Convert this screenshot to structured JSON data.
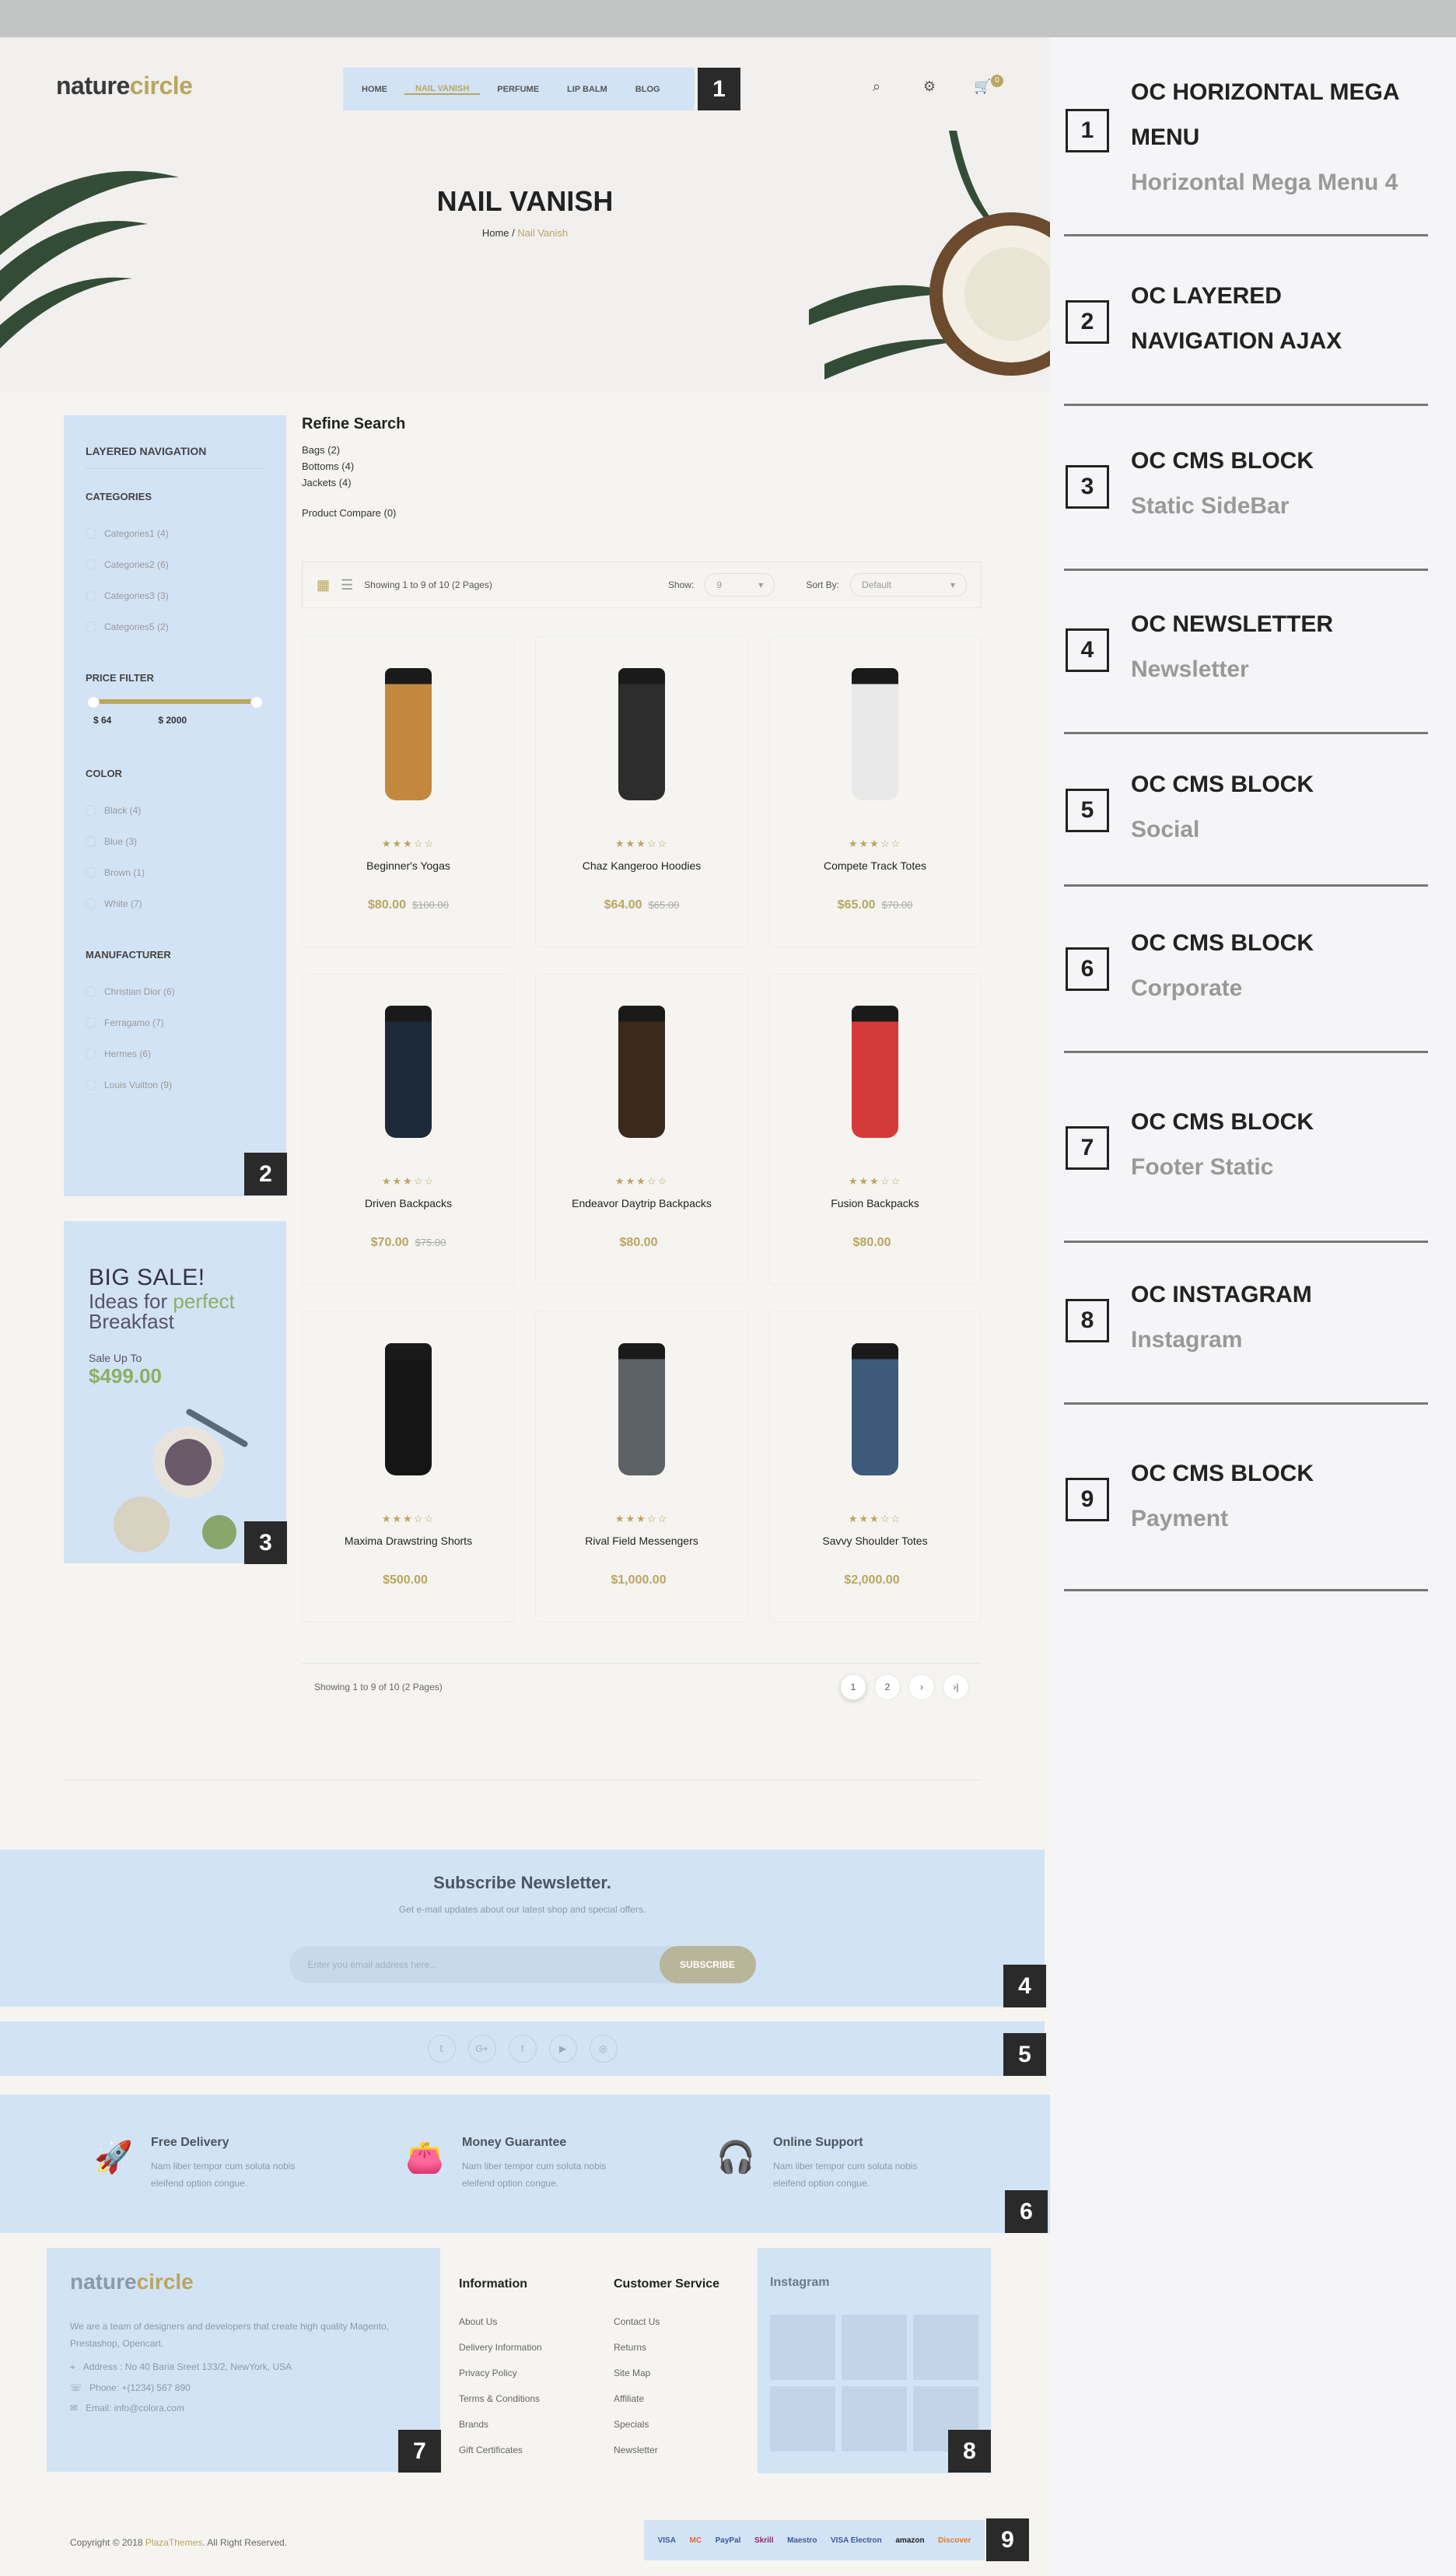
{
  "brand": {
    "name_a": "nature",
    "name_b": "circle"
  },
  "menu": {
    "items": [
      "HOME",
      "NAIL VANISH",
      "PERFUME",
      "LIP BALM",
      "BLOG"
    ]
  },
  "page": {
    "title": "NAIL VANISH",
    "breadcrumb_home": "Home",
    "breadcrumb_current": "Nail Vanish"
  },
  "sidebar": {
    "heading": "LAYERED NAVIGATION",
    "categories_title": "CATEGORIES",
    "categories": [
      "Categories1 (4)",
      "Categories2 (6)",
      "Categories3 (3)",
      "Categories5 (2)"
    ],
    "price_title": "PRICE FILTER",
    "price_min": "$ 64",
    "price_max": "$ 2000",
    "color_title": "COLOR",
    "colors": [
      "Black (4)",
      "Blue (3)",
      "Brown (1)",
      "White (7)"
    ],
    "manufacturer_title": "MANUFACTURER",
    "manufacturers": [
      "Christian Dior (6)",
      "Ferragamo (7)",
      "Hermes (6)",
      "Louis Vuitton (9)"
    ]
  },
  "banner": {
    "line1": "BIG SALE!",
    "line2a": "Ideas for ",
    "line2b": "perfect",
    "line3": "Breakfast",
    "line4": "Sale Up To",
    "price": "$499.00"
  },
  "refine": {
    "title": "Refine Search",
    "links": [
      "Bags (2)",
      "Bottoms (4)",
      "Jackets (4)"
    ],
    "compare": "Product Compare (0)"
  },
  "toolbar": {
    "showing": "Showing 1 to 9 of 10 (2 Pages)",
    "show_label": "Show:",
    "show_value": "9",
    "sort_label": "Sort By:",
    "sort_value": "Default"
  },
  "products": [
    {
      "name": "Beginner's Yogas",
      "price": "$80.00",
      "old": "$100.00",
      "color": "#c2893e"
    },
    {
      "name": "Chaz Kangeroo Hoodies",
      "price": "$64.00",
      "old": "$65.00",
      "color": "#2d2d2d"
    },
    {
      "name": "Compete Track Totes",
      "price": "$65.00",
      "old": "$70.00",
      "color": "#e9e9e9"
    },
    {
      "name": "Driven Backpacks",
      "price": "$70.00",
      "old": "$75.00",
      "color": "#1c2a38"
    },
    {
      "name": "Endeavor Daytrip Backpacks",
      "price": "$80.00",
      "old": "",
      "color": "#3a2a1e"
    },
    {
      "name": "Fusion Backpacks",
      "price": "$80.00",
      "old": "",
      "color": "#d43a3a"
    },
    {
      "name": "Maxima Drawstring Shorts",
      "price": "$500.00",
      "old": "",
      "color": "#151515"
    },
    {
      "name": "Rival Field Messengers",
      "price": "$1,000.00",
      "old": "",
      "color": "#5c6168"
    },
    {
      "name": "Savvy Shoulder Totes",
      "price": "$2,000.00",
      "old": "",
      "color": "#3d5a7a"
    }
  ],
  "pager": {
    "showing": "Showing 1 to 9 of 10 (2 Pages)",
    "pages": [
      "1",
      "2",
      "›",
      "›|"
    ]
  },
  "newsletter": {
    "title": "Subscribe Newsletter.",
    "text": "Get e-mail updates about our latest shop and special offers.",
    "placeholder": "Enter you email address here...",
    "button": "SUBSCRIBE"
  },
  "social": [
    "𝕥",
    "G+",
    "f",
    "▶",
    "◎"
  ],
  "corporate": [
    {
      "title": "Free Delivery",
      "text1": "Nam liber tempor cum soluta nobis",
      "text2": "eleifend option congue.",
      "icon": "rocket-icon"
    },
    {
      "title": "Money Guarantee",
      "text1": "Nam liber tempor cum soluta nobis",
      "text2": "eleifend option congue.",
      "icon": "wallet-icon"
    },
    {
      "title": "Online Support",
      "text1": "Nam liber tempor cum soluta nobis",
      "text2": "eleifend option congue.",
      "icon": "headset-icon"
    }
  ],
  "footer": {
    "about": "We are a team of designers and developers that create high quality Magento, Prestashop, Opencart.",
    "address": "Address : No 40 Baria Sreet 133/2, NewYork, USA",
    "phone": "Phone: +(1234) 567 890",
    "email": "Email: info@colora.com",
    "info_title": "Information",
    "info_links": [
      "About Us",
      "Delivery Information",
      "Privacy Policy",
      "Terms & Conditions",
      "Brands",
      "Gift Certificates"
    ],
    "cs_title": "Customer Service",
    "cs_links": [
      "Contact Us",
      "Returns",
      "Site Map",
      "Affiliate",
      "Specials",
      "Newsletter"
    ],
    "instagram_title": "Instagram",
    "copyright_a": "Copyright © 2018 ",
    "copyright_b": "PlazaThemes",
    "copyright_c": ". All Right Reserved."
  },
  "payments": [
    "VISA",
    "MC",
    "PayPal",
    "Skrill",
    "Maestro",
    "VISA Electron",
    "amazon",
    "Discover"
  ],
  "legend": [
    {
      "n": "1",
      "title": "OC HORIZONTAL MEGA MENU",
      "sub": "Horizontal Mega Menu 4"
    },
    {
      "n": "2",
      "title": "OC LAYERED NAVIGATION AJAX",
      "sub": ""
    },
    {
      "n": "3",
      "title": "OC CMS BLOCK",
      "sub": "Static SideBar"
    },
    {
      "n": "4",
      "title": "OC NEWSLETTER",
      "sub": "Newsletter"
    },
    {
      "n": "5",
      "title": "OC CMS BLOCK",
      "sub": "Social"
    },
    {
      "n": "6",
      "title": "OC CMS BLOCK",
      "sub": "Corporate"
    },
    {
      "n": "7",
      "title": "OC CMS BLOCK",
      "sub": "Footer Static"
    },
    {
      "n": "8",
      "title": "OC INSTAGRAM",
      "sub": "Instagram"
    },
    {
      "n": "9",
      "title": "OC CMS BLOCK",
      "sub": "Payment"
    }
  ],
  "colors": {
    "accent": "#b9a660",
    "highlight": "#d3e3f6"
  }
}
